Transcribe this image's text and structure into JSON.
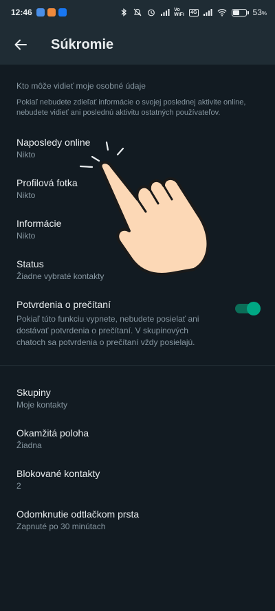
{
  "status_bar": {
    "time": "12:46",
    "battery_percent": "53",
    "battery_level": 0.53,
    "net_labels": [
      "Vo WiFi",
      "4G"
    ]
  },
  "app_bar": {
    "title": "Súkromie",
    "back_icon": "arrow-back-icon"
  },
  "personal_info": {
    "header": "Kto môže vidieť moje osobné údaje",
    "description": "Pokiaľ nebudete zdieľať informácie o svojej poslednej aktivite online, nebudete vidieť ani poslednú aktivitu ostatných používateľov.",
    "items": [
      {
        "label": "Naposledy online",
        "value": "Nikto"
      },
      {
        "label": "Profilová fotka",
        "value": "Nikto"
      },
      {
        "label": "Informácie",
        "value": "Nikto"
      },
      {
        "label": "Status",
        "value": "Žiadne vybraté kontakty"
      }
    ],
    "read_receipts": {
      "label": "Potvrdenia o prečítaní",
      "description": "Pokiaľ túto funkciu vypnete, nebudete posielať ani dostávať potvrdenia o prečítaní. V skupinových chatoch sa potvrdenia o prečítaní vždy posielajú.",
      "enabled": true
    }
  },
  "other_settings": {
    "items": [
      {
        "label": "Skupiny",
        "value": "Moje kontakty"
      },
      {
        "label": "Okamžitá poloha",
        "value": "Žiadna"
      },
      {
        "label": "Blokované kontakty",
        "value": "2"
      },
      {
        "label": "Odomknutie odtlačkom prsta",
        "value": "Zapnuté po 30 minútach"
      }
    ]
  },
  "colors": {
    "background": "#121b22",
    "bar": "#1f2c34",
    "accent": "#00a884",
    "secondary_text": "#8696a0"
  }
}
